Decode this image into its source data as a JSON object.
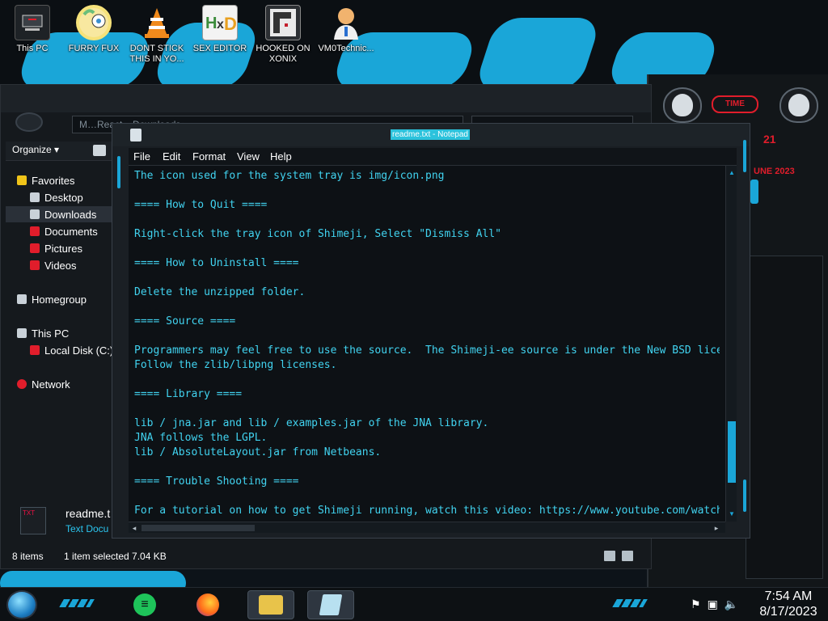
{
  "desktop": {
    "icons": [
      {
        "label": "This PC"
      },
      {
        "label": "FURRY FUX"
      },
      {
        "label": "DONT STICK THIS IN YO..."
      },
      {
        "label": "SEX EDITOR"
      },
      {
        "label": "HOOKED ON XONIX"
      },
      {
        "label": "VM0Technic..."
      }
    ]
  },
  "explorer": {
    "address_text": "M…React ▸ Downloads ▸ …",
    "toolbar": {
      "organize_label": "Organize ▾"
    },
    "nav": {
      "favorites": "Favorites",
      "desktop": "Desktop",
      "downloads": "Downloads",
      "documents": "Documents",
      "pictures": "Pictures",
      "videos": "Videos",
      "homegroup": "Homegroup",
      "this_pc": "This PC",
      "local_disk": "Local Disk (C:)",
      "network": "Network"
    },
    "file": {
      "name": "readme.t",
      "type": "Text Docu",
      "icon_text": "TXT"
    },
    "status": {
      "count": "8 items",
      "selected": "1 item selected  7.04 KB"
    }
  },
  "gadget": {
    "badge": "TIME",
    "line1": "21",
    "line2": "UNE 2023"
  },
  "notepad": {
    "title": "readme.txt - Notepad",
    "menu": [
      "File",
      "Edit",
      "Format",
      "View",
      "Help"
    ],
    "content": "The icon used for the system tray is img/icon.png\n\n==== How to Quit ====\n\nRight-click the tray icon of Shimeji, Select \"Dismiss All\"\n\n==== How to Uninstall ====\n\nDelete the unzipped folder.\n\n==== Source ====\n\nProgrammers may feel free to use the source.  The Shimeji-ee source is under the New BSD license.\nFollow the zlib/libpng licenses.\n\n==== Library ====\n\nlib / jna.jar and lib / examples.jar of the JNA library.\nJNA follows the LGPL.\nlib / AbsoluteLayout.jar from Netbeans.\n\n==== Trouble Shooting ====\n\nFor a tutorial on how to get Shimeji running, watch this video: https://www.youtube.com/watch"
  },
  "taskbar": {
    "time": "7:54 AM",
    "date": "8/17/2023",
    "tray_icons": [
      "flag-icon",
      "network-icon",
      "volume-icon"
    ]
  },
  "colors": {
    "accent": "#1aa6d8",
    "notepad_text": "#41d3f0",
    "alert_red": "#e11d2b"
  }
}
